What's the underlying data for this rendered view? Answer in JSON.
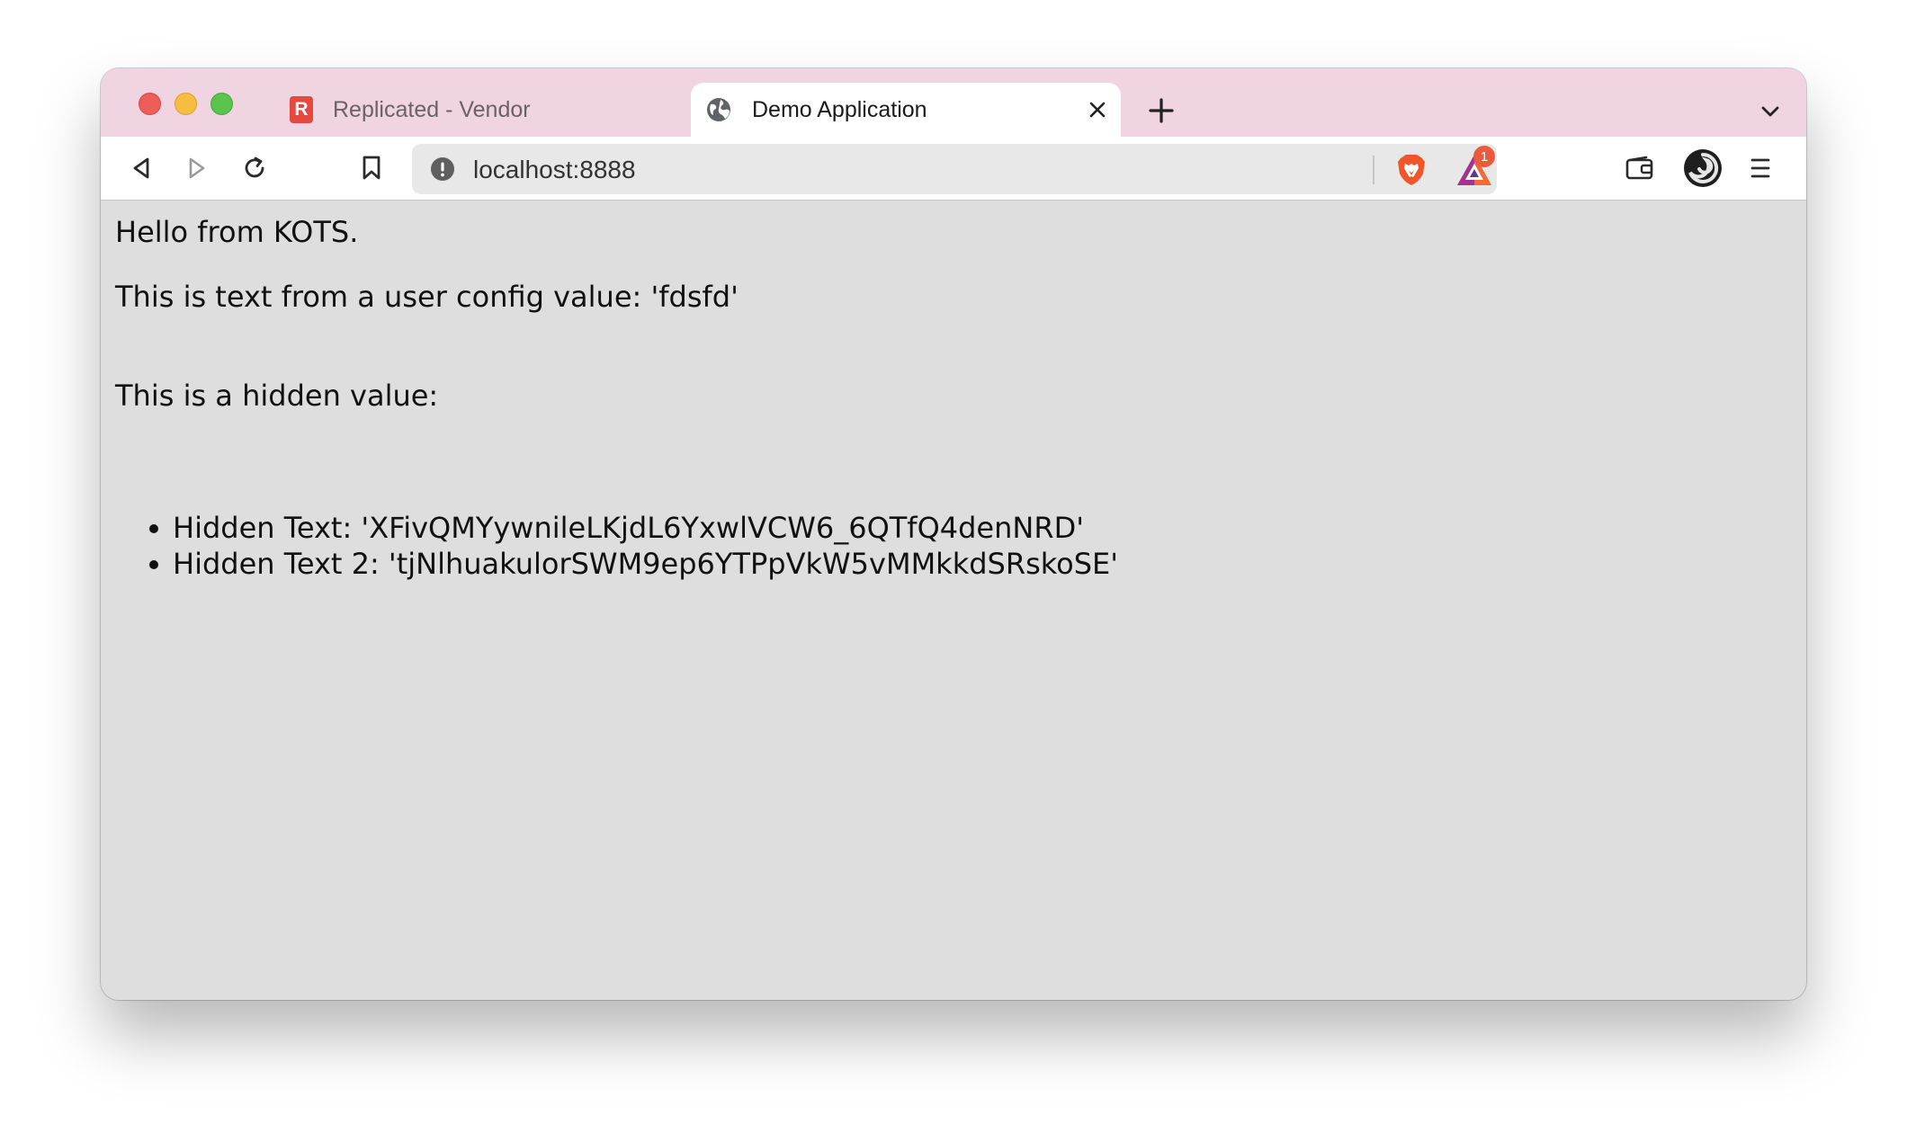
{
  "browser": {
    "tabs": [
      {
        "label": "Replicated - Vendor",
        "icon": "replicated-r-icon",
        "active": false
      },
      {
        "label": "Demo Application",
        "icon": "globe-icon",
        "active": true
      }
    ],
    "address": "localhost:8888",
    "rewards_badge": "1",
    "colors": {
      "tabstrip": "#f0d4e2",
      "page_background": "#dedede",
      "brave_orange": "#f1562b"
    }
  },
  "page": {
    "greeting": "Hello from KOTS.",
    "config_line": "This is text from a user config value: 'fdsfd'",
    "hidden_heading": "This is a hidden value:",
    "hidden_items": [
      "Hidden Text: 'XFivQMYywnileLKjdL6YxwlVCW6_6QTfQ4denNRD'",
      "Hidden Text 2: 'tjNlhuakulorSWM9ep6YTPpVkW5vMMkkdSRskoSE'"
    ]
  }
}
